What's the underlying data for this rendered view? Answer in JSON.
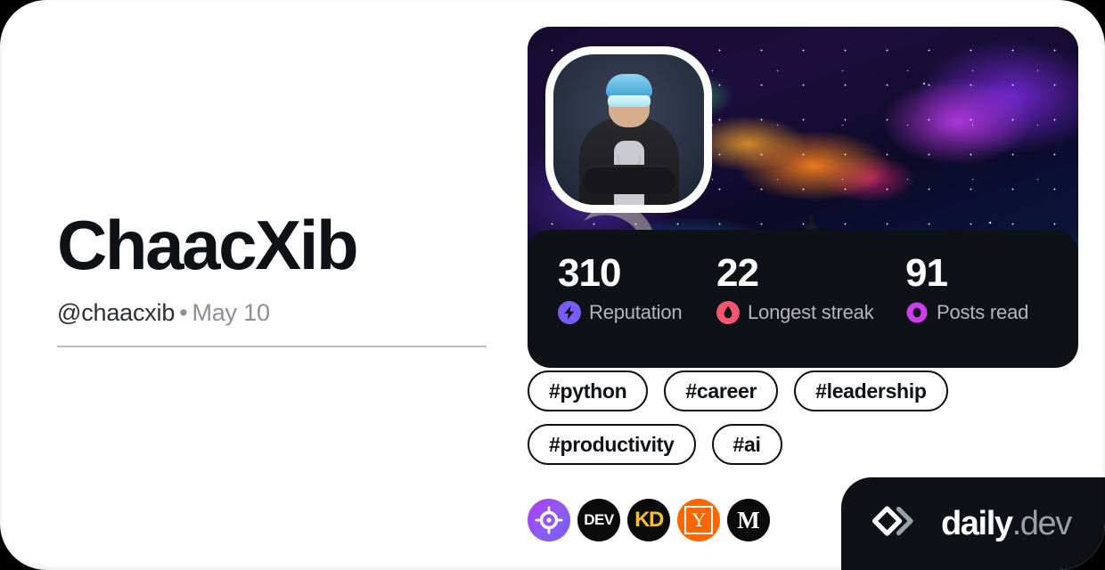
{
  "profile": {
    "display_name": "ChaacXib",
    "handle": "@chaacxib",
    "separator": "•",
    "joined": "May 10",
    "avatar_alt": "user-avatar"
  },
  "stats": [
    {
      "value": "310",
      "label": "Reputation",
      "icon": "reputation-bolt-icon",
      "color": "#7B5CFA"
    },
    {
      "value": "22",
      "label": "Longest streak",
      "icon": "streak-flame-icon",
      "color": "#F4576F"
    },
    {
      "value": "91",
      "label": "Posts read",
      "icon": "posts-read-ring-icon",
      "color": "#CE3DF3"
    }
  ],
  "tags": [
    "#python",
    "#career",
    "#leadership",
    "#productivity",
    "#ai"
  ],
  "sources": [
    {
      "name": "daily-dev-source-icon",
      "label": "",
      "kind": "target"
    },
    {
      "name": "devto-source-icon",
      "label": "DEV",
      "kind": "text"
    },
    {
      "name": "kdnuggets-source-icon",
      "label": "KD",
      "kind": "text"
    },
    {
      "name": "hackernews-source-icon",
      "label": "Y",
      "kind": "boxed"
    },
    {
      "name": "medium-source-icon",
      "label": "M",
      "kind": "text"
    }
  ],
  "brand": {
    "name": "daily",
    "tld": ".dev"
  },
  "colors": {
    "card_bg": "#FFFFFF",
    "page_bg": "#000000",
    "ink": "#0E1217",
    "muted": "#8B9098",
    "reputation": "#7B5CFA",
    "streak": "#F4576F",
    "posts_read": "#CE3DF3",
    "devto": "#0B0B0B",
    "kdnuggets": "#F5C024",
    "hackernews": "#FF6600",
    "medium": "#0B0B0B"
  }
}
